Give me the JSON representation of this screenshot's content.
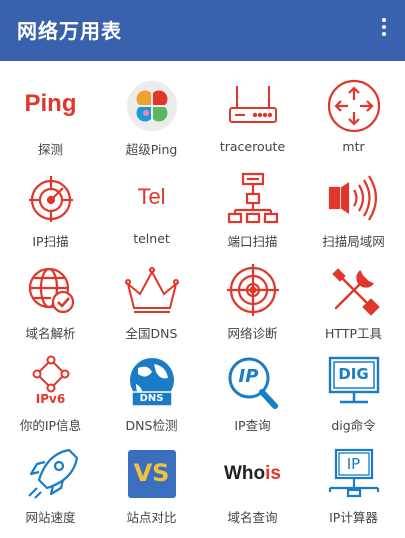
{
  "app": {
    "title": "网络万用表",
    "menu_icon": "more-vert-icon"
  },
  "accent_red": "#e0372c",
  "accent_blue": "#1a7cc7",
  "tools": [
    {
      "label": "探测",
      "icon": "ping-text-icon",
      "icon_text": "Ping"
    },
    {
      "label": "超级Ping",
      "icon": "colorful-flower-icon"
    },
    {
      "label": "traceroute",
      "icon": "router-icon"
    },
    {
      "label": "mtr",
      "icon": "circle-arrows-icon"
    },
    {
      "label": "IP扫描",
      "icon": "radar-target-icon"
    },
    {
      "label": "telnet",
      "icon": "tel-text-icon",
      "icon_text": "Tel"
    },
    {
      "label": "端口扫描",
      "icon": "network-topology-icon"
    },
    {
      "label": "扫描局域网",
      "icon": "signal-waves-icon"
    },
    {
      "label": "域名解析",
      "icon": "globe-check-icon"
    },
    {
      "label": "全国DNS",
      "icon": "crown-icon"
    },
    {
      "label": "网络诊断",
      "icon": "crosshair-globe-icon"
    },
    {
      "label": "HTTP工具",
      "icon": "wrench-screwdriver-icon"
    },
    {
      "label": "你的IP信息",
      "icon": "ipv6-nodes-icon",
      "icon_text": "IPv6"
    },
    {
      "label": "DNS检测",
      "icon": "dns-globe-icon",
      "icon_text": "DNS"
    },
    {
      "label": "IP查询",
      "icon": "ip-magnifier-icon",
      "icon_text": "IP"
    },
    {
      "label": "dig命令",
      "icon": "dig-monitor-icon",
      "icon_text": "DIG"
    },
    {
      "label": "网站速度",
      "icon": "rocket-icon"
    },
    {
      "label": "站点对比",
      "icon": "vs-icon",
      "icon_text": "VS"
    },
    {
      "label": "域名查询",
      "icon": "whois-text-icon",
      "icon_text_a": "Who",
      "icon_text_b": "is"
    },
    {
      "label": "IP计算器",
      "icon": "ip-monitor-icon",
      "icon_text": "IP"
    }
  ]
}
